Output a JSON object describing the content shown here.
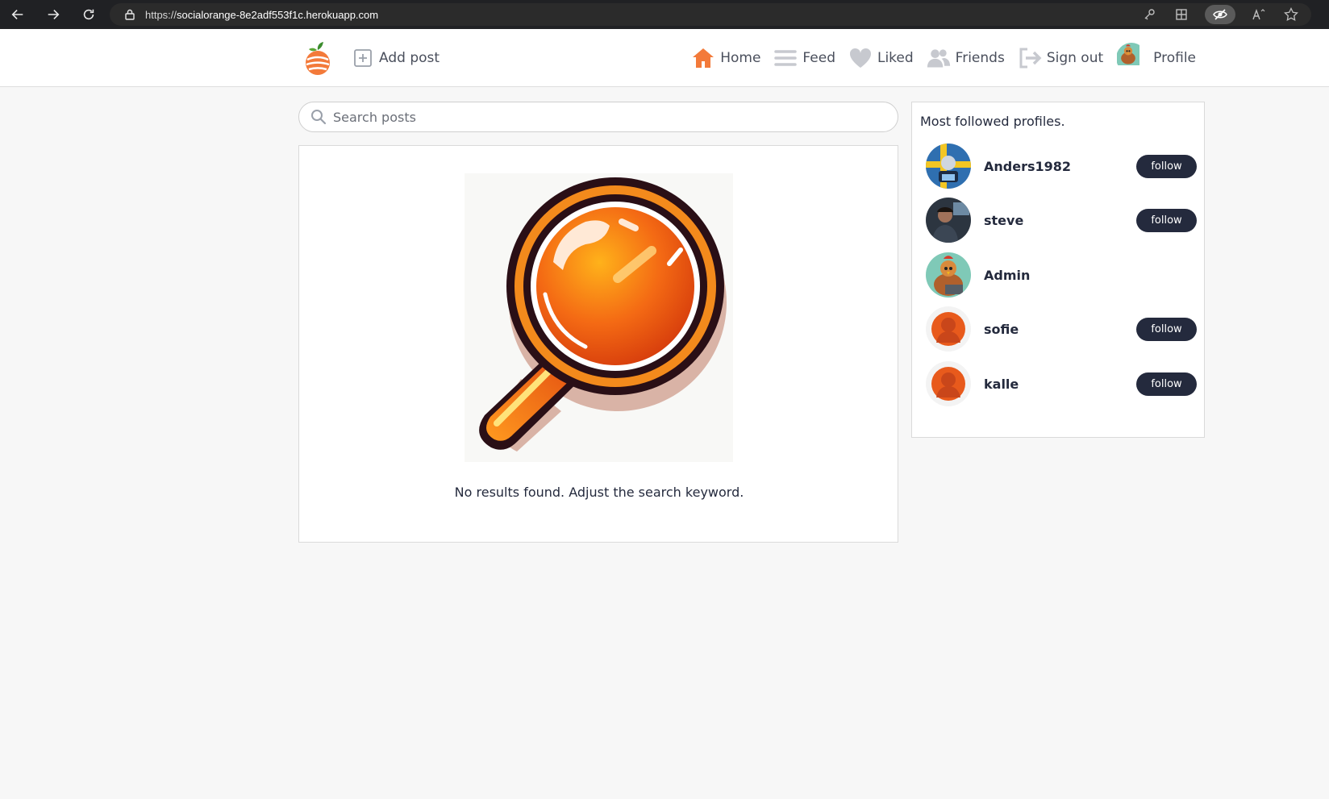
{
  "browser": {
    "url_scheme": "https://",
    "url_host": "socialorange-8e2adf553f1c.herokuapp.com"
  },
  "header": {
    "add_post_label": "Add post",
    "nav": {
      "home": "Home",
      "feed": "Feed",
      "liked": "Liked",
      "friends": "Friends",
      "sign_out": "Sign out",
      "profile": "Profile"
    }
  },
  "search": {
    "placeholder": "Search posts",
    "value": ""
  },
  "results": {
    "empty_message": "No results found. Adjust the search keyword."
  },
  "sidebar": {
    "title": "Most followed profiles.",
    "profiles": [
      {
        "name": "Anders1982",
        "follow_label": "follow"
      },
      {
        "name": "steve",
        "follow_label": "follow"
      },
      {
        "name": "Admin",
        "follow_label": ""
      },
      {
        "name": "sofie",
        "follow_label": "follow"
      },
      {
        "name": "kalle",
        "follow_label": "follow"
      }
    ]
  },
  "colors": {
    "brand_orange": "#f37a3a",
    "dark_navy": "#242a3d",
    "nav_icon_gray": "#c7c9cf"
  }
}
